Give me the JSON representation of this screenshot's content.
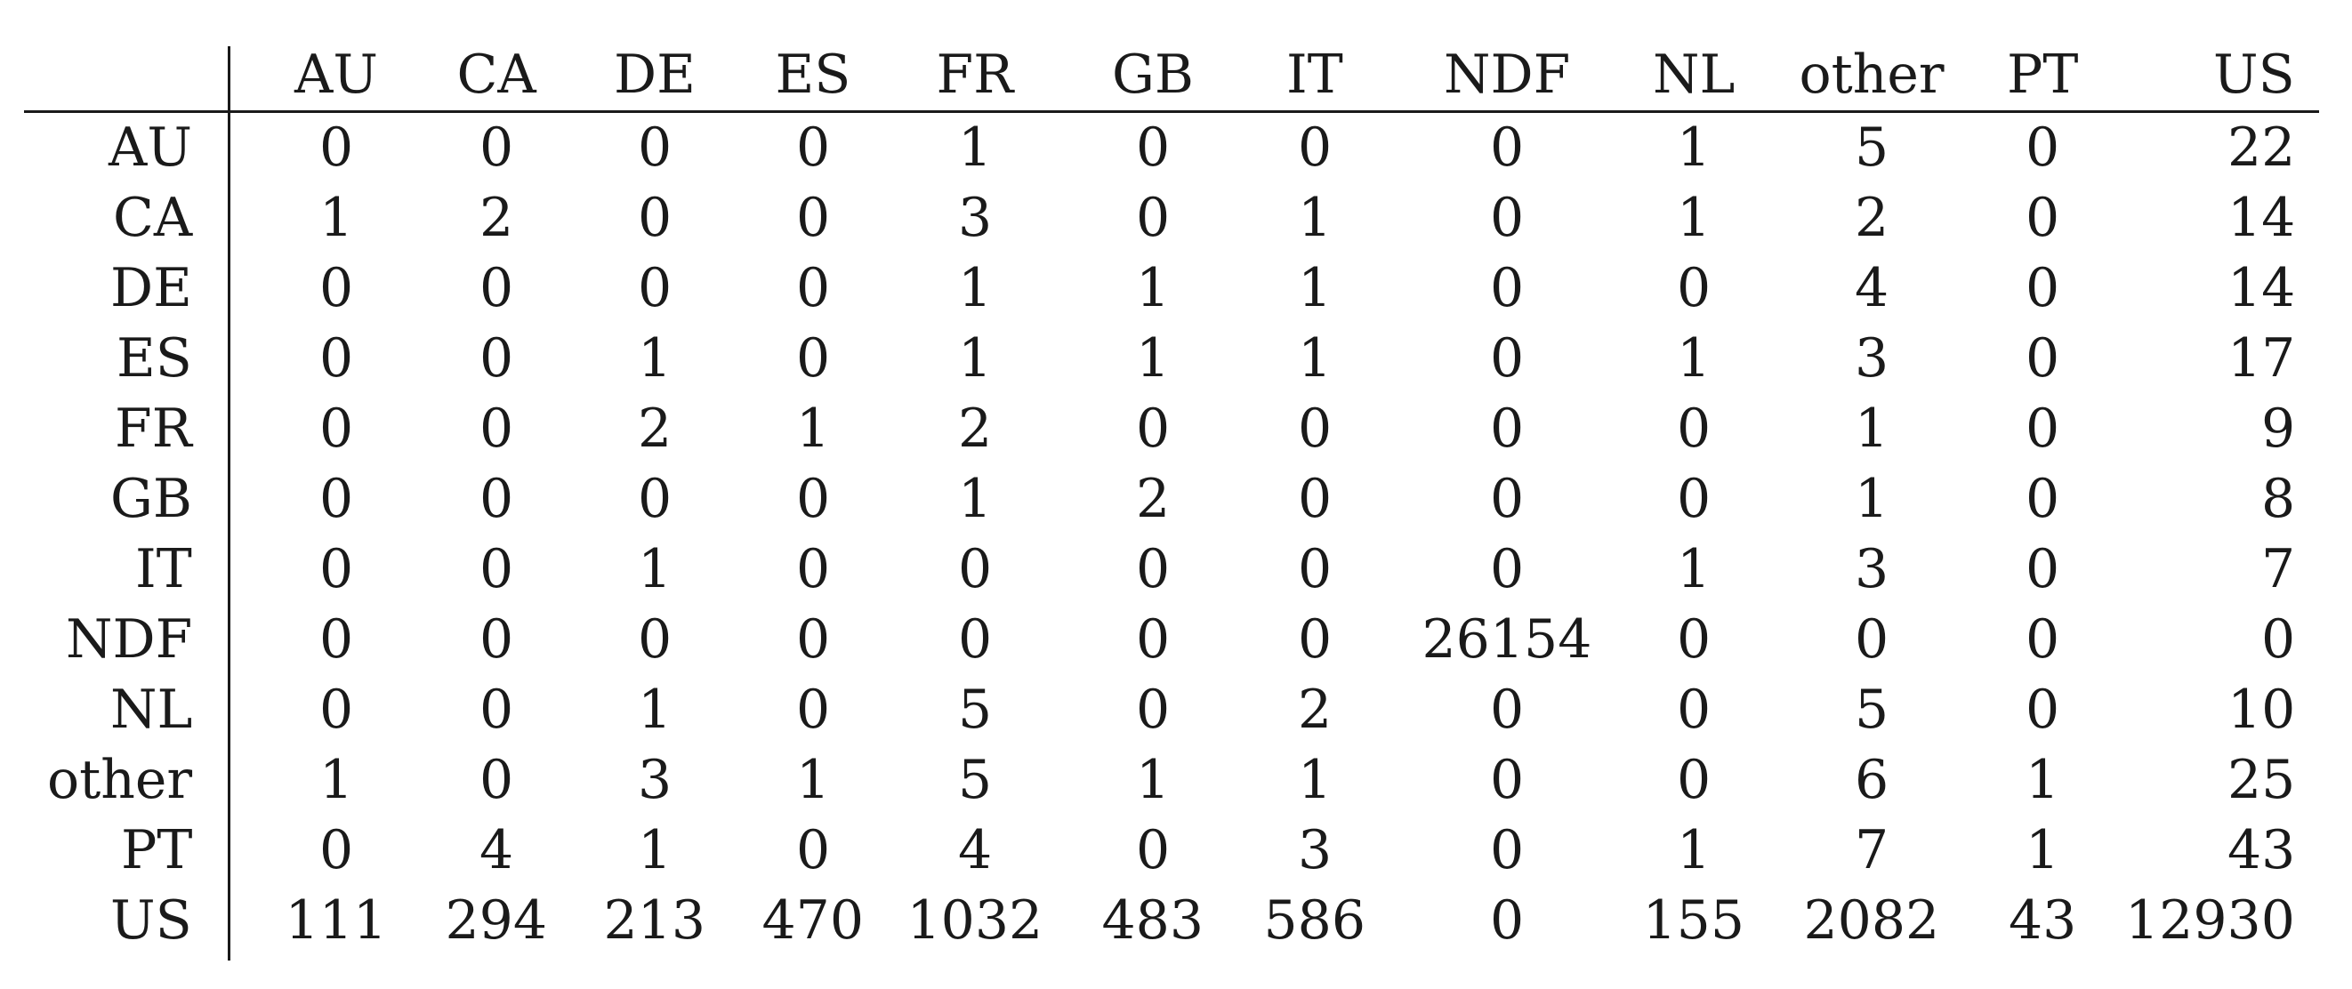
{
  "chart_data": {
    "type": "table",
    "columns": [
      "AU",
      "CA",
      "DE",
      "ES",
      "FR",
      "GB",
      "IT",
      "NDF",
      "NL",
      "other",
      "PT",
      "US"
    ],
    "rows": [
      "AU",
      "CA",
      "DE",
      "ES",
      "FR",
      "GB",
      "IT",
      "NDF",
      "NL",
      "other",
      "PT",
      "US"
    ],
    "values": [
      [
        0,
        0,
        0,
        0,
        1,
        0,
        0,
        0,
        1,
        5,
        0,
        22
      ],
      [
        1,
        2,
        0,
        0,
        3,
        0,
        1,
        0,
        1,
        2,
        0,
        14
      ],
      [
        0,
        0,
        0,
        0,
        1,
        1,
        1,
        0,
        0,
        4,
        0,
        14
      ],
      [
        0,
        0,
        1,
        0,
        1,
        1,
        1,
        0,
        1,
        3,
        0,
        17
      ],
      [
        0,
        0,
        2,
        1,
        2,
        0,
        0,
        0,
        0,
        1,
        0,
        9
      ],
      [
        0,
        0,
        0,
        0,
        1,
        2,
        0,
        0,
        0,
        1,
        0,
        8
      ],
      [
        0,
        0,
        1,
        0,
        0,
        0,
        0,
        0,
        1,
        3,
        0,
        7
      ],
      [
        0,
        0,
        0,
        0,
        0,
        0,
        0,
        26154,
        0,
        0,
        0,
        0
      ],
      [
        0,
        0,
        1,
        0,
        5,
        0,
        2,
        0,
        0,
        5,
        0,
        10
      ],
      [
        1,
        0,
        3,
        1,
        5,
        1,
        1,
        0,
        0,
        6,
        1,
        25
      ],
      [
        0,
        4,
        1,
        0,
        4,
        0,
        3,
        0,
        1,
        7,
        1,
        43
      ],
      [
        111,
        294,
        213,
        470,
        1032,
        483,
        586,
        0,
        155,
        2082,
        43,
        12930
      ]
    ]
  }
}
